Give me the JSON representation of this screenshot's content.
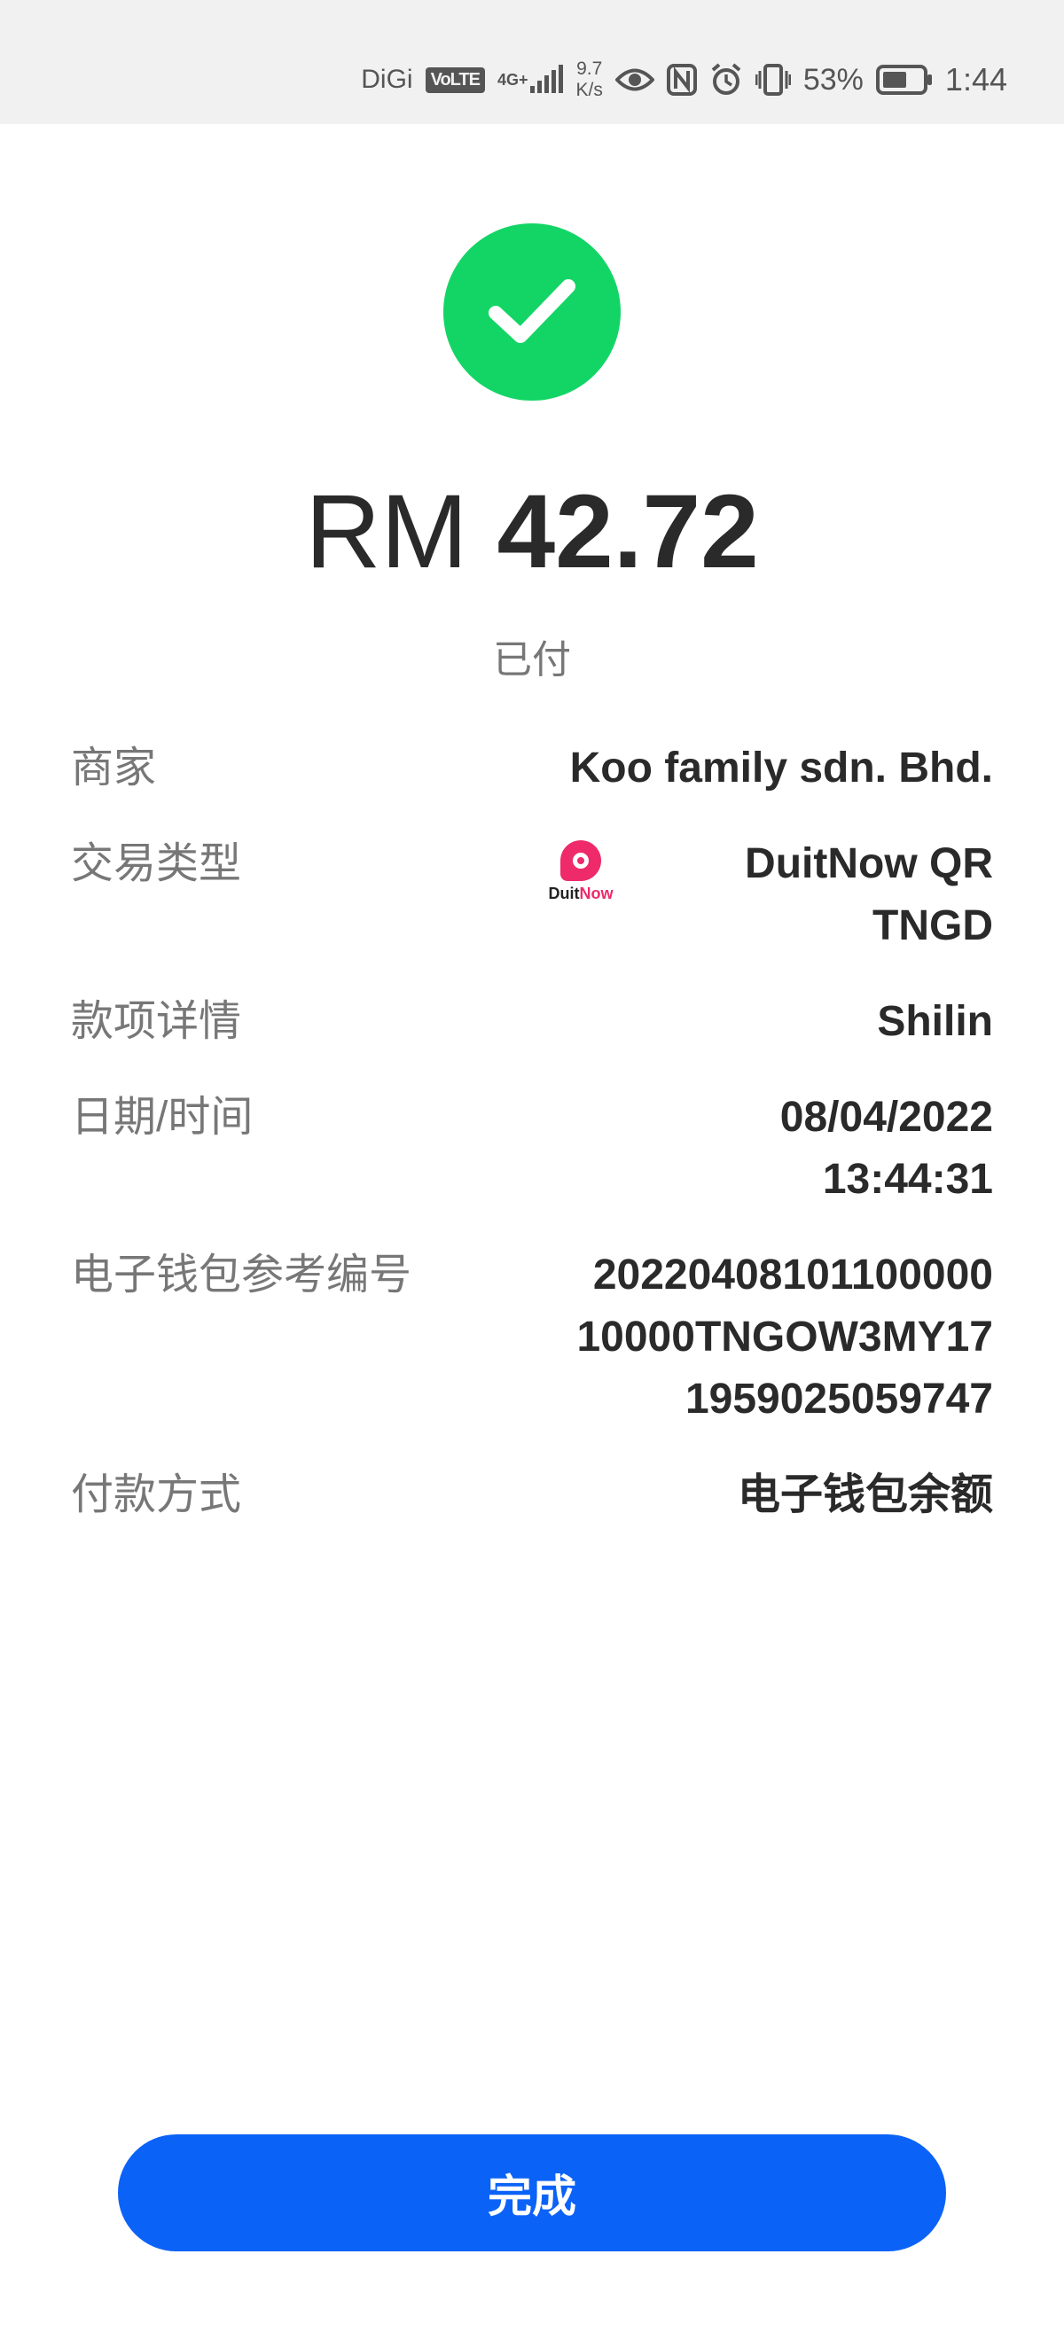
{
  "status_bar": {
    "carrier": "DiGi",
    "volte": "VoLTE",
    "network": "4G+",
    "speed_value": "9.7",
    "speed_unit": "K/s",
    "battery_percent": "53%",
    "time": "1:44"
  },
  "payment": {
    "currency": "RM",
    "amount": "42.72",
    "status": "已付",
    "success_color": "#13d566"
  },
  "details": {
    "merchant": {
      "label": "商家",
      "value": "Koo family sdn. Bhd."
    },
    "transaction_type": {
      "label": "交易类型",
      "value_line1": "DuitNow QR",
      "value_line2": "TNGD",
      "logo_text_a": "Duit",
      "logo_text_b": "Now"
    },
    "details": {
      "label": "款项详情",
      "value": "Shilin"
    },
    "datetime": {
      "label": "日期/时间",
      "date": "08/04/2022",
      "time": "13:44:31"
    },
    "reference": {
      "label": "电子钱包参考编号",
      "line1": "20220408101100000",
      "line2": "10000TNGOW3MY17",
      "line3": "1959025059747"
    },
    "payment_method": {
      "label": "付款方式",
      "value": "电子钱包余额"
    }
  },
  "done_button": {
    "label": "完成",
    "color": "#0b62f7"
  }
}
